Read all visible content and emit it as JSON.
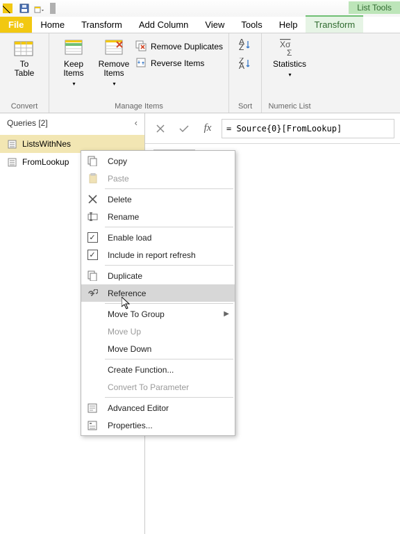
{
  "qat": {
    "list_tools": "List Tools"
  },
  "tabs": {
    "file": "File",
    "home": "Home",
    "transform": "Transform",
    "add_column": "Add Column",
    "view": "View",
    "tools": "Tools",
    "help": "Help",
    "transform2": "Transform"
  },
  "ribbon": {
    "convert": {
      "title": "Convert",
      "to_table": "To\nTable"
    },
    "manage": {
      "title": "Manage Items",
      "keep_items": "Keep\nItems",
      "remove_items": "Remove\nItems",
      "remove_dups": "Remove Duplicates",
      "reverse": "Reverse Items"
    },
    "sort": {
      "title": "Sort"
    },
    "numeric": {
      "title": "Numeric List",
      "statistics": "Statistics"
    }
  },
  "queries": {
    "title": "Queries [2]",
    "items": [
      "ListsWithNes",
      "FromLookup"
    ]
  },
  "formula": {
    "value": "= Source{0}[FromLookup]"
  },
  "ctx": {
    "copy": "Copy",
    "paste": "Paste",
    "delete": "Delete",
    "rename": "Rename",
    "enable_load": "Enable load",
    "include_refresh": "Include in report refresh",
    "duplicate": "Duplicate",
    "reference": "Reference",
    "move_group": "Move To Group",
    "move_up": "Move Up",
    "move_down": "Move Down",
    "create_fn": "Create Function...",
    "to_param": "Convert To Parameter",
    "adv_editor": "Advanced Editor",
    "properties": "Properties..."
  }
}
